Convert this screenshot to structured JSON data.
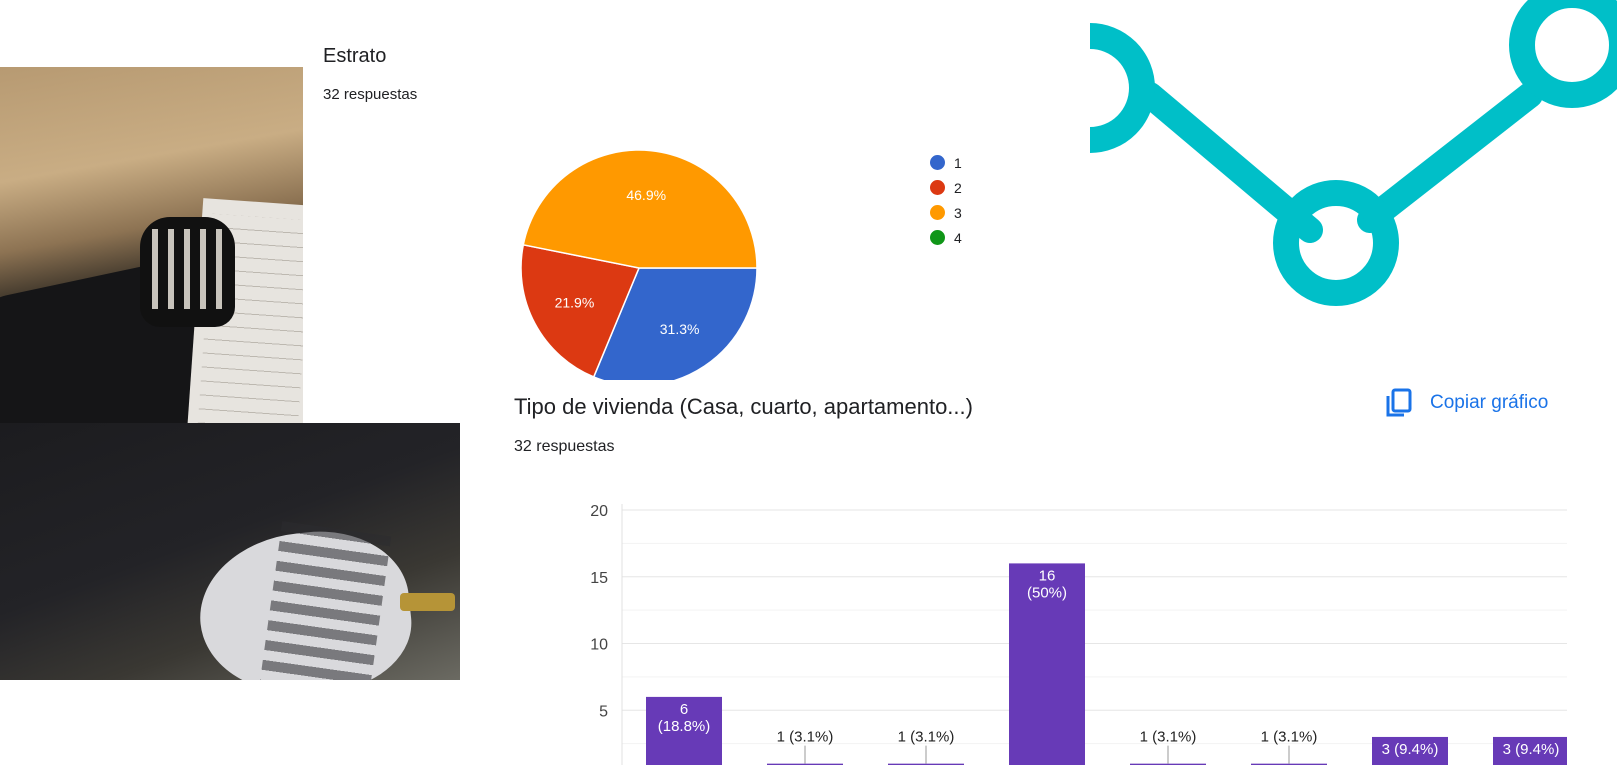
{
  "photo": {
    "icon": "photo-collage"
  },
  "connector": {
    "color": "#00bfc8",
    "icon": "connector-graphic"
  },
  "strata_question": {
    "title": "Estrato",
    "responses": "32 respuestas",
    "chart_data": {
      "type": "pie",
      "slices": [
        {
          "label": "1",
          "value": 31.3,
          "display": "31.3%",
          "color": "#3366cc"
        },
        {
          "label": "2",
          "value": 21.9,
          "display": "21.9%",
          "color": "#dc3912"
        },
        {
          "label": "3",
          "value": 46.9,
          "display": "46.9%",
          "color": "#ff9900"
        },
        {
          "label": "4",
          "value": 0,
          "display": "",
          "color": "#109618"
        }
      ],
      "legend_position": "right"
    }
  },
  "housing_question": {
    "title": "Tipo de vivienda (Casa, cuarto, apartamento...)",
    "responses": "32 respuestas",
    "copy_label": "Copiar gráfico",
    "chart_data": {
      "type": "bar",
      "values": [
        6,
        1,
        1,
        16,
        1,
        1,
        3,
        3
      ],
      "labels": [
        "6\n(18.8%)",
        "1 (3.1%)",
        "1 (3.1%)",
        "16\n(50%)",
        "1 (3.1%)",
        "1 (3.1%)",
        "3 (9.4%)",
        "3 (9.4%)"
      ],
      "yticks": [
        20,
        15,
        10,
        5
      ],
      "ylim": [
        0,
        20
      ],
      "grid": true,
      "color": "#673ab7"
    }
  }
}
